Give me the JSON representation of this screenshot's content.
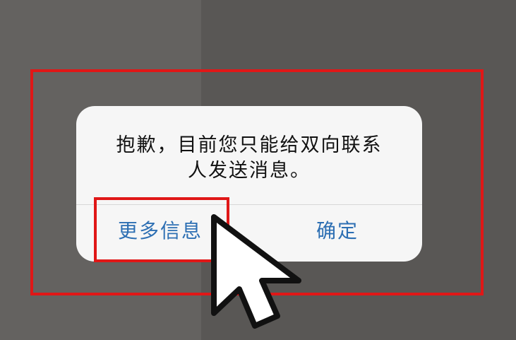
{
  "dialog": {
    "message": "抱歉，目前您只能给双向联系\n人发送消息。",
    "more_info_label": "更多信息",
    "ok_label": "确定"
  },
  "icons": {
    "cursor": "mouse-pointer-icon"
  },
  "colors": {
    "highlight": "#e01717",
    "action_text": "#2d6fb3",
    "dialog_background": "#f6f6f6"
  }
}
